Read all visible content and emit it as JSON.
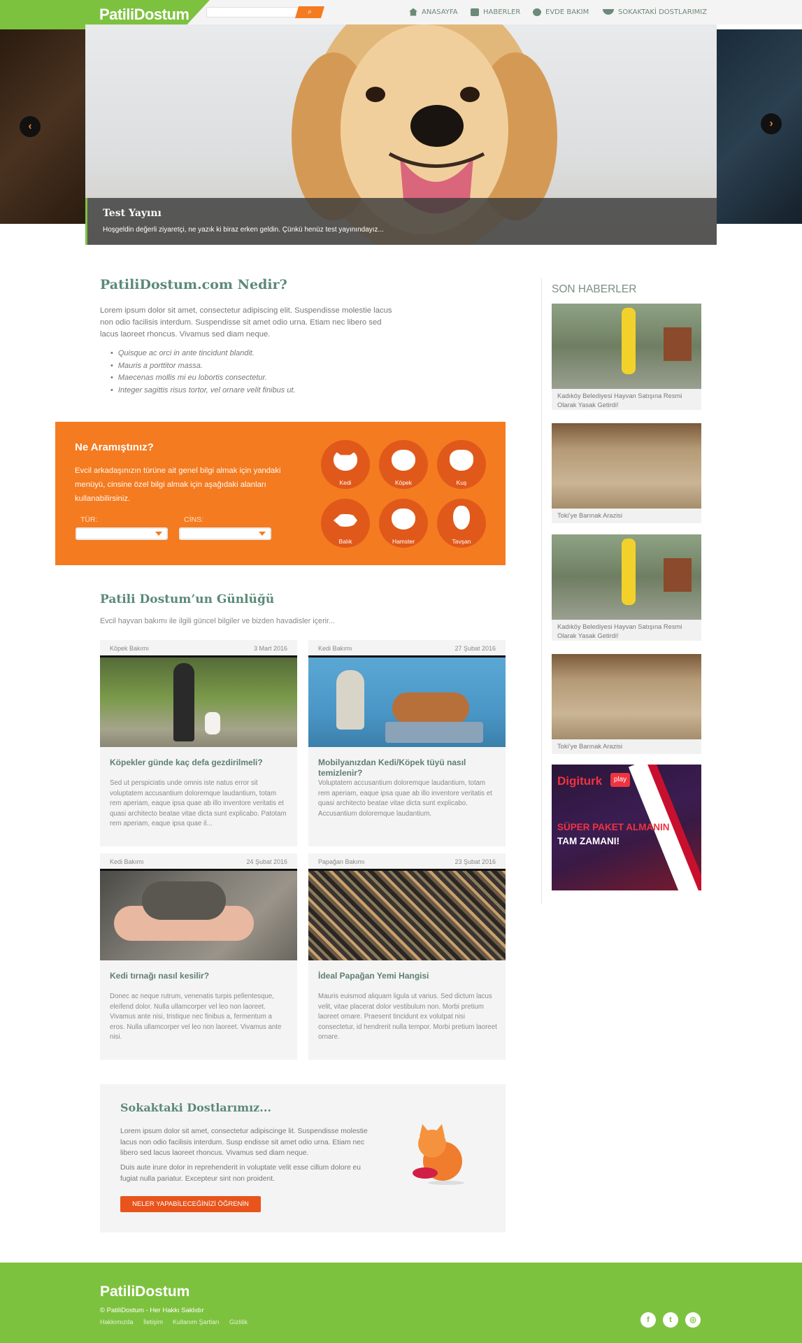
{
  "header": {
    "logo": "PatiliDostum",
    "search_icon": "search-icon",
    "nav": [
      {
        "label": "ANASAYFA",
        "icon": "home-icon"
      },
      {
        "label": "HABERLER",
        "icon": "news-icon"
      },
      {
        "label": "EVDE BAKIM",
        "icon": "pet-care-icon"
      },
      {
        "label": "SOKAKTAKİ DOSTLARIMIZ",
        "icon": "food-bowl-icon"
      }
    ]
  },
  "hero": {
    "title": "Test Yayını",
    "subtitle": "Hoşgeldin değerli ziyaretçi, ne yazık ki biraz erken geldin. Çünkü henüz test yayınındayız...",
    "prev": "‹",
    "next": "›"
  },
  "intro": {
    "title": "PatiliDostum.com Nedir?",
    "text": "Lorem ipsum dolor sit amet, consectetur adipiscing elit. Suspendisse molestie lacus non odio facilisis interdum. Suspendisse sit amet odio urna. Etiam nec libero sed lacus laoreet rhoncus. Vivamus sed diam neque.",
    "list": [
      "Quisque ac orci in ante tincidunt blandit.",
      "Mauris a porttitor massa.",
      "Maecenas mollis mi eu lobortis consectetur.",
      "Integer sagittis risus tortor, vel ornare velit finibus ut."
    ]
  },
  "finder": {
    "title": "Ne Aramıştınız?",
    "text": "Evcil arkadaşınızın türüne ait genel bilgi almak için yandaki menüyü, cinsine özel bilgi almak için aşağıdaki alanları kullanabilirsiniz.",
    "type_label": "TÜR:",
    "breed_label": "CİNS:",
    "pets": [
      "Kedi",
      "Köpek",
      "Kuş",
      "Balık",
      "Hamster",
      "Tavşan"
    ]
  },
  "blog": {
    "title": "Patili Dostum’un Günlüğü",
    "subtitle": "Evcil hayvan bakımı ile ilgili güncel bilgiler ve bizden havadisler içerir...",
    "posts": [
      {
        "category": "Köpek Bakımı",
        "date": "3 Mart 2016",
        "title": "Köpekler günde kaç defa gezdirilmeli?",
        "text": "Sed ut perspiciatis unde omnis iste natus error sit voluptatem accusantium doloremque laudantium, totam rem aperiam, eaque ipsa quae ab illo inventore veritatis et quasi architecto beatae vitae dicta sunt explicabo. Patotam rem aperiam, eaque ipsa quae il..."
      },
      {
        "category": "Kedi Bakımı",
        "date": "27 Şubat 2016",
        "title": "Mobilyanızdan Kedi/Köpek tüyü nasıl temizlenir?",
        "text": "Voluptatem accusantium doloremque laudantium, totam rem aperiam, eaque ipsa quae ab illo inventore veritatis et quasi architecto beatae vitae dicta sunt explicabo. Accusantium doloremque laudantium."
      },
      {
        "category": "Kedi Bakımı",
        "date": "24 Şubat 2016",
        "title": "Kedi tırnağı nasıl kesilir?",
        "text": "Donec ac neque rutrum, venenatis turpis pellentesque, eleifend dolor. Nulla ullamcorper vel leo non laoreet. Vivamus ante nisi, tristique nec finibus a, fermentum a eros. Nulla ullamcorper vel leo non laoreet. Vivamus ante nisi."
      },
      {
        "category": "Papağan Bakımı",
        "date": "23 Şubat 2016",
        "title": "İdeal Papağan Yemi Hangisi",
        "text": "Mauris euismod aliquam ligula ut varius. Sed dictum lacus velit, vitae placerat dolor vestibulum non. Morbi pretium laoreet ornare. Praesent tincidunt ex volutpat nisi consectetur, id hendrerit nulla tempor. Morbi pretium laoreet ornare."
      }
    ]
  },
  "street": {
    "title": "Sokaktaki Dostlarımız...",
    "text1": "Lorem ipsum dolor sit amet, consectetur adipiscinge lit. Suspendisse molestie lacus non odio facilisis interdum. Susp endisse sit amet odio urna. Etiam nec libero sed lacus laoreet rhoncus. Vivamus sed diam neque.",
    "text2": "Duis aute irure dolor in reprehenderit in voluptate velit esse cillum dolore eu fugiat nulla pariatur. Excepteur sint non proident.",
    "button": "NELER YAPABİLECEĞİNİZİ ÖĞRENİN"
  },
  "sidebar": {
    "title": "SON HABERLER",
    "news": [
      "Kadıköy Belediyesi Hayvan Satışına Resmi Olarak Yasak Getirdi!",
      "Toki’ye Barınak Arazisi",
      "Kadıköy Belediyesi Hayvan Satışına Resmi Olarak Yasak Getirdi!",
      "Toki’ye Barınak Arazisi"
    ],
    "ad": {
      "brand": "Digiturk",
      "badge": "play",
      "line1": "SÜPER PAKET ALMANIN",
      "line2": "TAM ZAMANI!"
    }
  },
  "footer": {
    "logo": "PatiliDostum",
    "copyright": "© PatiliDostum - Her Hakkı Saklıdır",
    "links": [
      "Hakkımızda",
      "İletişim",
      "Kullanım Şartları",
      "Gizlilik"
    ],
    "social": [
      {
        "icon": "facebook-icon",
        "glyph": "f"
      },
      {
        "icon": "twitter-icon",
        "glyph": "t"
      },
      {
        "icon": "instagram-icon",
        "glyph": "◎"
      }
    ]
  },
  "colors": {
    "brand_green": "#7dc23f",
    "accent_orange": "#f47b20",
    "heading_green": "#5b8a77"
  }
}
